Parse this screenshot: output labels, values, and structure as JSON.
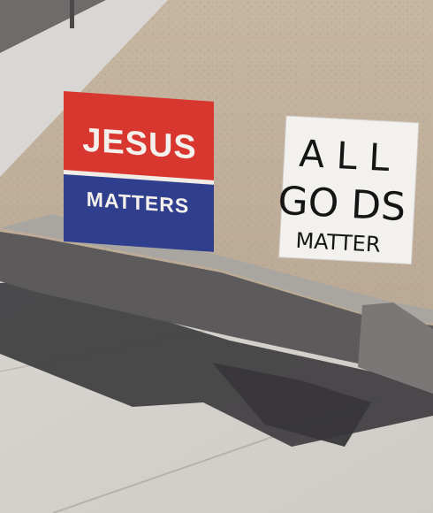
{
  "signs": {
    "left": {
      "line1": "JESUS",
      "line2": "MATTERS",
      "colors": {
        "top": "#d9352e",
        "bottom": "#2f3f8f",
        "text": "#f4f1ec"
      }
    },
    "right": {
      "line1": "A L L",
      "line2": "GO DS",
      "line3": "MATTER",
      "colors": {
        "board": "#f3f1ee",
        "ink": "#151515"
      }
    }
  },
  "scene": {
    "ground_color": "#cbbba8",
    "sidewalk_color": "#d6d3cf",
    "curb_color": "#8c8986",
    "shadow_color": "#3b3a3b"
  }
}
